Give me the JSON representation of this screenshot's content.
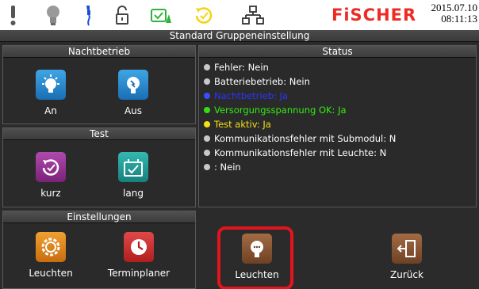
{
  "toolbar": {
    "icons": [
      "exclamation-icon",
      "lightbulb-icon",
      "plug-icon",
      "padlock-icon",
      "battery-check-icon",
      "cycle-test-icon",
      "network-icon"
    ],
    "brand": "FiSCHER",
    "date": "2015.07.10",
    "time": "08:11:13"
  },
  "screen_title": "Standard Gruppeneinstellung",
  "nachtbetrieb": {
    "title": "Nachtbetrieb",
    "on_label": "An",
    "off_label": "Aus"
  },
  "test": {
    "title": "Test",
    "short_label": "kurz",
    "long_label": "lang"
  },
  "einstellungen": {
    "title": "Einstellungen",
    "leuchten_label": "Leuchten",
    "terminplaner_label": "Terminplaner"
  },
  "status": {
    "title": "Status",
    "items": [
      {
        "text": "Fehler: Nein",
        "dot_color": "#c8c8c8",
        "text_color": "#ffffff"
      },
      {
        "text": "Batteriebetrieb: Nein",
        "dot_color": "#c8c8c8",
        "text_color": "#ffffff"
      },
      {
        "text": "Nachtbetrieb: Ja",
        "dot_color": "#3b4cff",
        "text_color": "#2a35ff"
      },
      {
        "text": "Versorgungsspannung OK: Ja",
        "dot_color": "#33dd11",
        "text_color": "#33ee11"
      },
      {
        "text": "Test aktiv: Ja",
        "dot_color": "#f5e012",
        "text_color": "#f5e012"
      },
      {
        "text": "Kommunikationsfehler mit Submodul: N",
        "dot_color": "#c8c8c8",
        "text_color": "#ffffff"
      },
      {
        "text": "Kommunikationsfehler mit Leuchte: N",
        "dot_color": "#c8c8c8",
        "text_color": "#ffffff"
      },
      {
        "text": ": Nein",
        "dot_color": "#c8c8c8",
        "text_color": "#ffffff"
      }
    ]
  },
  "bottom_actions": {
    "leuchten_label": "Leuchten",
    "zurueck_label": "Zurück"
  },
  "colors": {
    "brand": "#ee2a24",
    "highlight": "#e4141e"
  }
}
